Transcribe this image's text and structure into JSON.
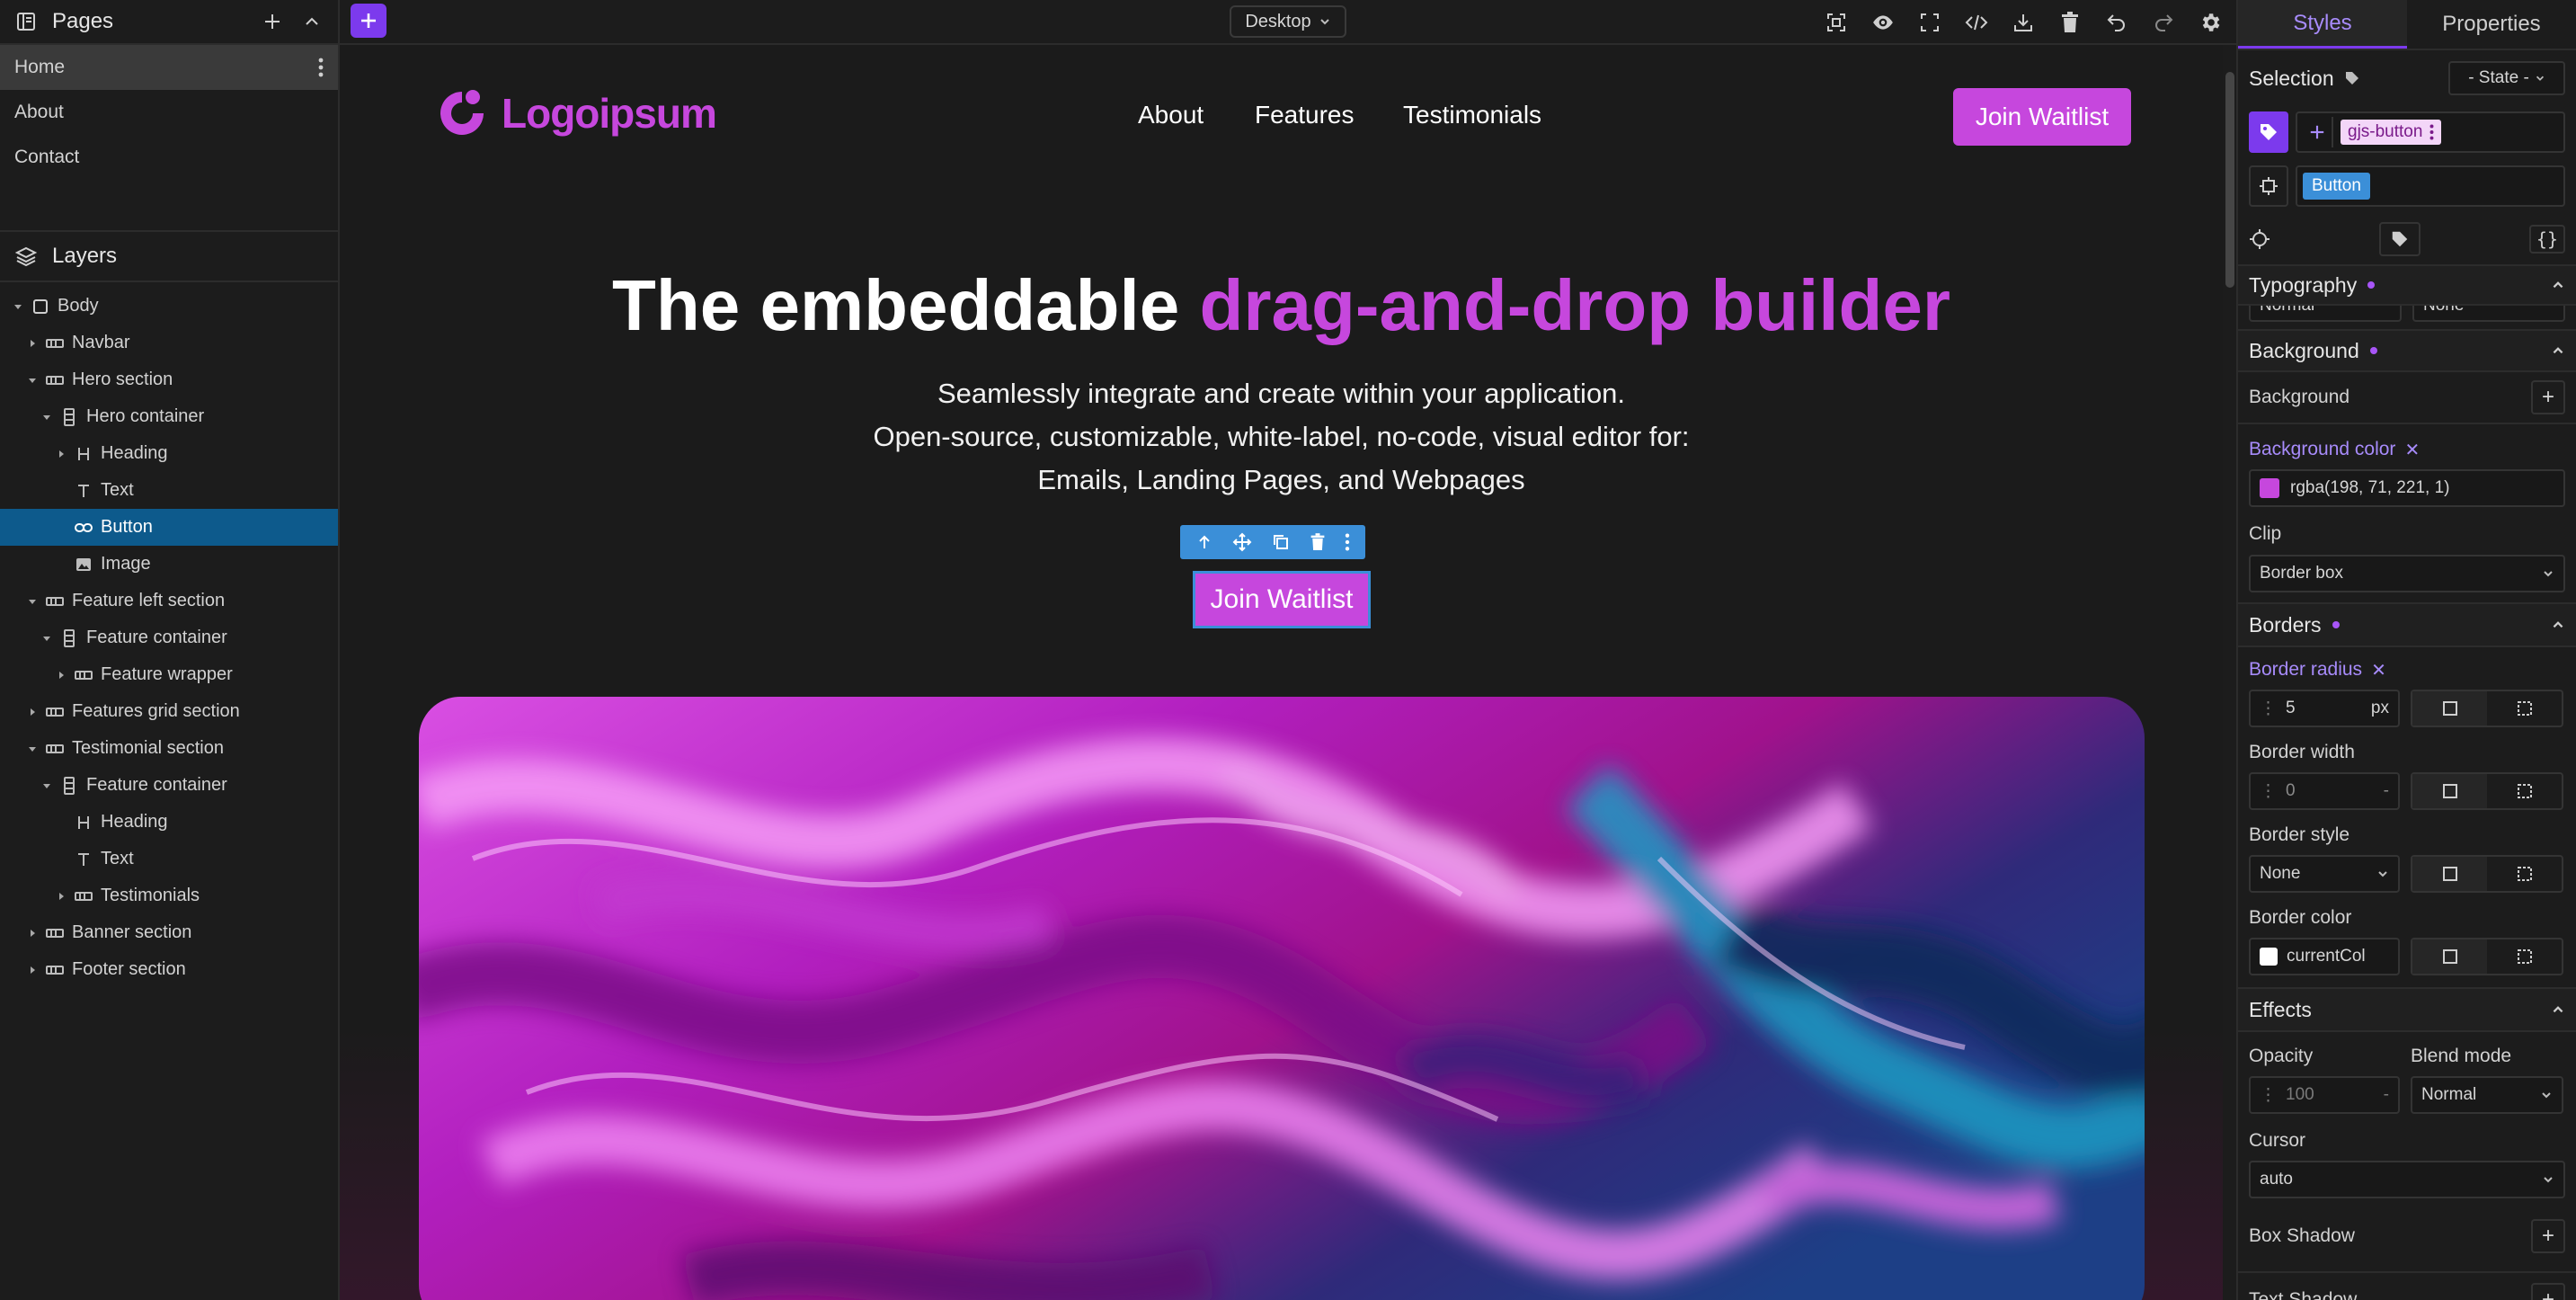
{
  "pages_panel": {
    "title": "Pages",
    "items": [
      {
        "label": "Home"
      },
      {
        "label": "About"
      },
      {
        "label": "Contact"
      }
    ]
  },
  "layers_panel": {
    "title": "Layers",
    "items": [
      {
        "label": "Body",
        "level": 0,
        "caret": "down",
        "icon": "square-icon"
      },
      {
        "label": "Navbar",
        "level": 1,
        "caret": "right",
        "icon": "section-icon"
      },
      {
        "label": "Hero section",
        "level": 1,
        "caret": "down",
        "icon": "section-icon"
      },
      {
        "label": "Hero container",
        "level": 2,
        "caret": "down",
        "icon": "container-icon"
      },
      {
        "label": "Heading",
        "level": 3,
        "caret": "right",
        "icon": "heading-icon"
      },
      {
        "label": "Text",
        "level": 3,
        "caret": "none",
        "icon": "text-icon"
      },
      {
        "label": "Button",
        "level": 3,
        "caret": "none",
        "icon": "link-icon",
        "selected": true
      },
      {
        "label": "Image",
        "level": 3,
        "caret": "none",
        "icon": "image-icon"
      },
      {
        "label": "Feature left section",
        "level": 1,
        "caret": "down",
        "icon": "section-icon"
      },
      {
        "label": "Feature container",
        "level": 2,
        "caret": "down",
        "icon": "container-icon"
      },
      {
        "label": "Feature wrapper",
        "level": 3,
        "caret": "right",
        "icon": "section-icon"
      },
      {
        "label": "Features grid section",
        "level": 1,
        "caret": "right",
        "icon": "section-icon"
      },
      {
        "label": "Testimonial section",
        "level": 1,
        "caret": "down",
        "icon": "section-icon"
      },
      {
        "label": "Feature container",
        "level": 2,
        "caret": "down",
        "icon": "container-icon"
      },
      {
        "label": "Heading",
        "level": 3,
        "caret": "none",
        "icon": "heading-icon"
      },
      {
        "label": "Text",
        "level": 3,
        "caret": "none",
        "icon": "text-icon"
      },
      {
        "label": "Testimonials",
        "level": 3,
        "caret": "right",
        "icon": "section-icon"
      },
      {
        "label": "Banner section",
        "level": 1,
        "caret": "right",
        "icon": "section-icon"
      },
      {
        "label": "Footer section",
        "level": 1,
        "caret": "right",
        "icon": "section-icon"
      }
    ]
  },
  "toolbar": {
    "device": "Desktop",
    "icons": [
      "fullscreen-icon",
      "preview-eye-icon",
      "outline-icon",
      "code-icon",
      "download-icon",
      "trash-icon",
      "undo-icon",
      "redo-icon",
      "settings-gear-icon"
    ]
  },
  "canvas": {
    "logo_text": "Logoipsum",
    "nav": [
      "About",
      "Features",
      "Testimonials"
    ],
    "cta_top": "Join Waitlist",
    "hero_heading_plain": "The embeddable ",
    "hero_heading_accent": "drag-and-drop builder",
    "hero_lines": [
      "Seamlessly integrate and create within your application.",
      "Open-source, customizable, white-label, no-code, visual editor for:",
      "Emails, Landing Pages, and Webpages"
    ],
    "hero_button": "Join Waitlist",
    "accent_color": "#c647dd",
    "selection_color": "#3b8fd8"
  },
  "styles_panel": {
    "tabs": [
      "Styles",
      "Properties"
    ],
    "selection_label": "Selection",
    "state_select": "- State -",
    "class_tag": "gjs-button",
    "component_badge": "Button",
    "typography": {
      "title": "Typography",
      "cut_values": [
        "Normal",
        "None"
      ]
    },
    "background": {
      "title": "Background",
      "bg_label": "Background",
      "color_label": "Background color",
      "color_value": "rgba(198, 71, 221, 1)",
      "swatch": "#c647dd",
      "clip_label": "Clip",
      "clip_value": "Border box"
    },
    "borders": {
      "title": "Borders",
      "radius_label": "Border radius",
      "radius_value": "5",
      "radius_unit": "px",
      "width_label": "Border width",
      "width_value": "0",
      "width_unit": "-",
      "style_label": "Border style",
      "style_value": "None",
      "color_label": "Border color",
      "color_value": "currentCol"
    },
    "effects": {
      "title": "Effects",
      "opacity_label": "Opacity",
      "opacity_value": "100",
      "opacity_unit": "-",
      "blend_label": "Blend mode",
      "blend_value": "Normal",
      "cursor_label": "Cursor",
      "cursor_value": "auto",
      "box_shadow_label": "Box Shadow",
      "text_shadow_label": "Text Shadow"
    }
  }
}
